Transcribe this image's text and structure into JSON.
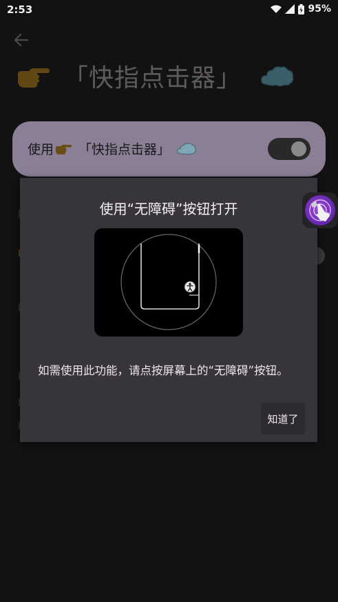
{
  "status_bar": {
    "time": "2:53",
    "battery_percent": "95%"
  },
  "page": {
    "title": "「快指点击器」"
  },
  "switch": {
    "label_prefix": "使用",
    "label_name": "「快指点击器」",
    "enabled": true
  },
  "dialog": {
    "title": "使用“无障碍”按钮打开",
    "message": "如需使用此功能，请点按屏幕上的“无障碍”按钮。",
    "ok_label": "知道了"
  },
  "colors": {
    "accent": "#8a7f95",
    "hand_emoji": "#b5832b",
    "cloud": "#7fd3e8"
  }
}
